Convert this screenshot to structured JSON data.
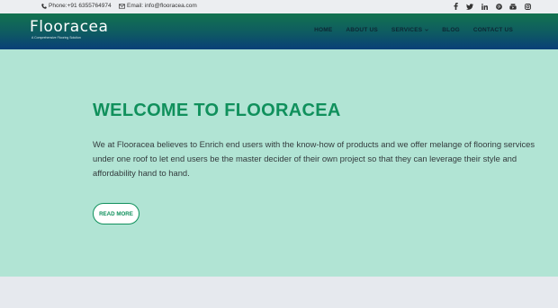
{
  "topbar": {
    "phone_icon": "phone-icon",
    "phone": "Phone:+91 6355764974",
    "email_icon": "envelope-icon",
    "email": "Email: info@flooracea.com",
    "socials": [
      "facebook-icon",
      "twitter-icon",
      "linkedin-icon",
      "pinterest-icon",
      "youtube-icon",
      "instagram-icon"
    ]
  },
  "logo": {
    "text": "Flooracea",
    "tagline": "A Comprehensive Flooring Solution"
  },
  "nav": {
    "home": "HOME",
    "about": "ABOUT US",
    "services": "SERVICES",
    "blog": "BLOG",
    "contact": "CONTACT US"
  },
  "hero": {
    "title": "WELCOME TO FLOORACEA",
    "description": "We at Flooracea believes to Enrich end users with the know-how of products and we offer melange of flooring services under one roof to let end users be the master decider of their own project so that they can leverage their style and affordability hand to hand.",
    "button": "READ MORE"
  },
  "colors": {
    "hero_bg": "#b1e4d4",
    "accent": "#10905c",
    "nav_gradient_top": "#13734f",
    "nav_gradient_bottom": "#0a3f78"
  }
}
